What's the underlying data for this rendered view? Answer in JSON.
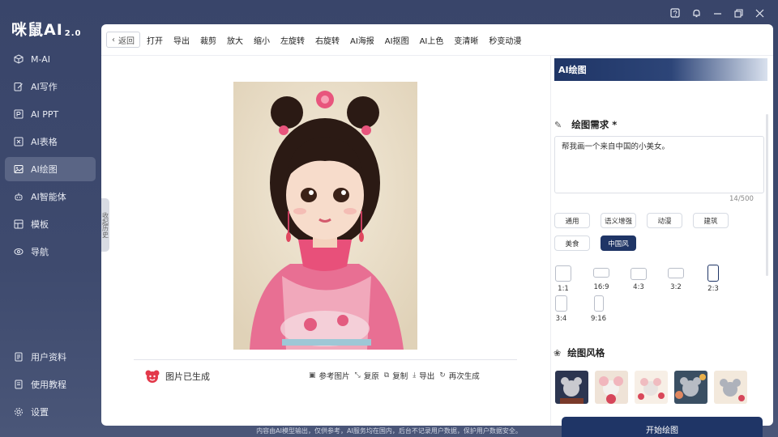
{
  "app": {
    "logo": "咪鼠AI",
    "version": "2.0"
  },
  "window_controls": [
    "help-icon",
    "bell-icon",
    "minimize-icon",
    "restore-icon",
    "close-icon"
  ],
  "sidebar": {
    "items": [
      {
        "label": "M-AI",
        "icon": "cube-icon"
      },
      {
        "label": "AI写作",
        "icon": "pen-icon"
      },
      {
        "label": "AI PPT",
        "icon": "ppt-icon"
      },
      {
        "label": "AI表格",
        "icon": "table-icon"
      },
      {
        "label": "AI绘图",
        "icon": "image-icon",
        "active": true
      },
      {
        "label": "AI智能体",
        "icon": "robot-icon"
      },
      {
        "label": "模板",
        "icon": "template-icon"
      },
      {
        "label": "导航",
        "icon": "compass-icon"
      }
    ],
    "bottom_items": [
      {
        "label": "用户资料",
        "icon": "user-doc-icon"
      },
      {
        "label": "使用教程",
        "icon": "book-icon"
      },
      {
        "label": "设置",
        "icon": "gear-icon"
      }
    ]
  },
  "toolbar": {
    "back": "返回",
    "items": [
      "打开",
      "导出",
      "裁剪",
      "放大",
      "缩小",
      "左旋转",
      "右旋转",
      "AI海报",
      "AI抠图",
      "AI上色",
      "变清晰",
      "秒变动漫"
    ]
  },
  "canvas": {
    "collapse_label": "收起历史",
    "status": "图片已生成",
    "actions": [
      {
        "label": "参考图片",
        "icon": "image-ref-icon"
      },
      {
        "label": "复原",
        "icon": "restore-icon"
      },
      {
        "label": "复制",
        "icon": "copy-icon"
      },
      {
        "label": "导出",
        "icon": "download-icon"
      },
      {
        "label": "再次生成",
        "icon": "refresh-icon"
      }
    ]
  },
  "right_panel": {
    "title": "AI绘图",
    "prompt_section": "绘图需求 *",
    "prompt_value": "帮我画一个来自中国的小美女。",
    "char_count": "14/500",
    "tags": [
      {
        "label": "通用"
      },
      {
        "label": "语义增强"
      },
      {
        "label": "动漫"
      },
      {
        "label": "建筑"
      },
      {
        "label": "美食"
      },
      {
        "label": "中国风",
        "selected": true
      }
    ],
    "ratios": [
      {
        "label": "1:1"
      },
      {
        "label": "16:9"
      },
      {
        "label": "4:3"
      },
      {
        "label": "3:2"
      },
      {
        "label": "2:3",
        "selected": true
      },
      {
        "label": "3:4"
      },
      {
        "label": "9:16"
      }
    ],
    "style_section": "绘图风格",
    "start_button": "开始绘图"
  },
  "footer": "内容由AI模型输出，仅供参考，AI服务均在国内，后台不记录用户数据，保护用户数据安全。",
  "colors": {
    "accent": "#1f3566",
    "sidebar_bg": "#3b476b",
    "active_nav": "#5a6585"
  }
}
